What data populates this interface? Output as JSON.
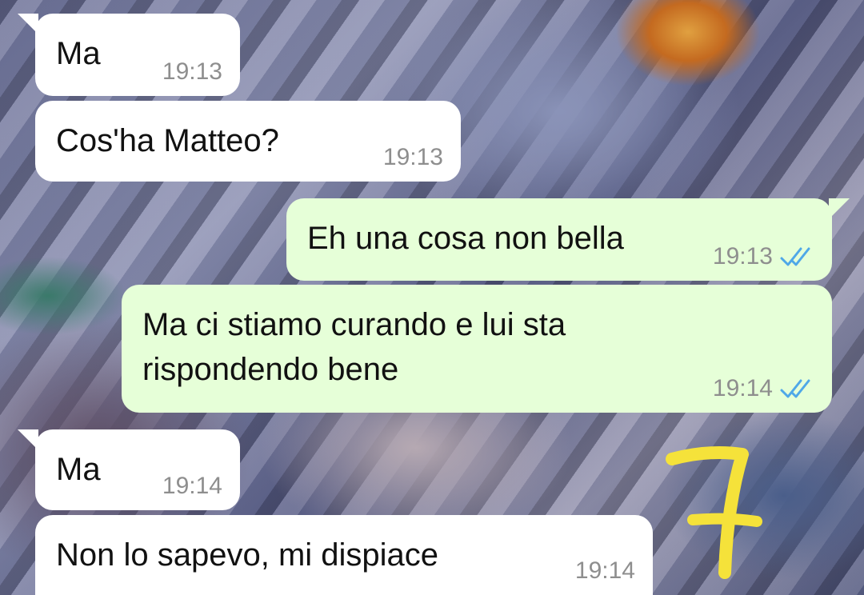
{
  "chat": {
    "messages": [
      {
        "direction": "incoming",
        "text": "Ma",
        "time": "19:13"
      },
      {
        "direction": "incoming",
        "text": "Cos'ha Matteo?",
        "time": "19:13"
      },
      {
        "direction": "outgoing",
        "text": "Eh una cosa non bella",
        "time": "19:13",
        "status": "read"
      },
      {
        "direction": "outgoing",
        "text": "Ma ci stiamo curando e lui sta\nrispondendo bene",
        "time": "19:14",
        "status": "read"
      },
      {
        "direction": "incoming",
        "text": "Ma",
        "time": "19:14"
      },
      {
        "direction": "incoming",
        "text": "Non lo sapevo, mi dispiace",
        "time": "19:14"
      }
    ]
  },
  "overlay": {
    "sticker_text": "7",
    "sticker_color": "#f5e23a"
  },
  "colors": {
    "incoming_bubble": "#ffffff",
    "outgoing_bubble": "#e6ffd8",
    "timestamp": "#8e8e8e",
    "read_ticks": "#4fa8e8"
  },
  "icons": {
    "read_receipt": "double-check-icon"
  }
}
